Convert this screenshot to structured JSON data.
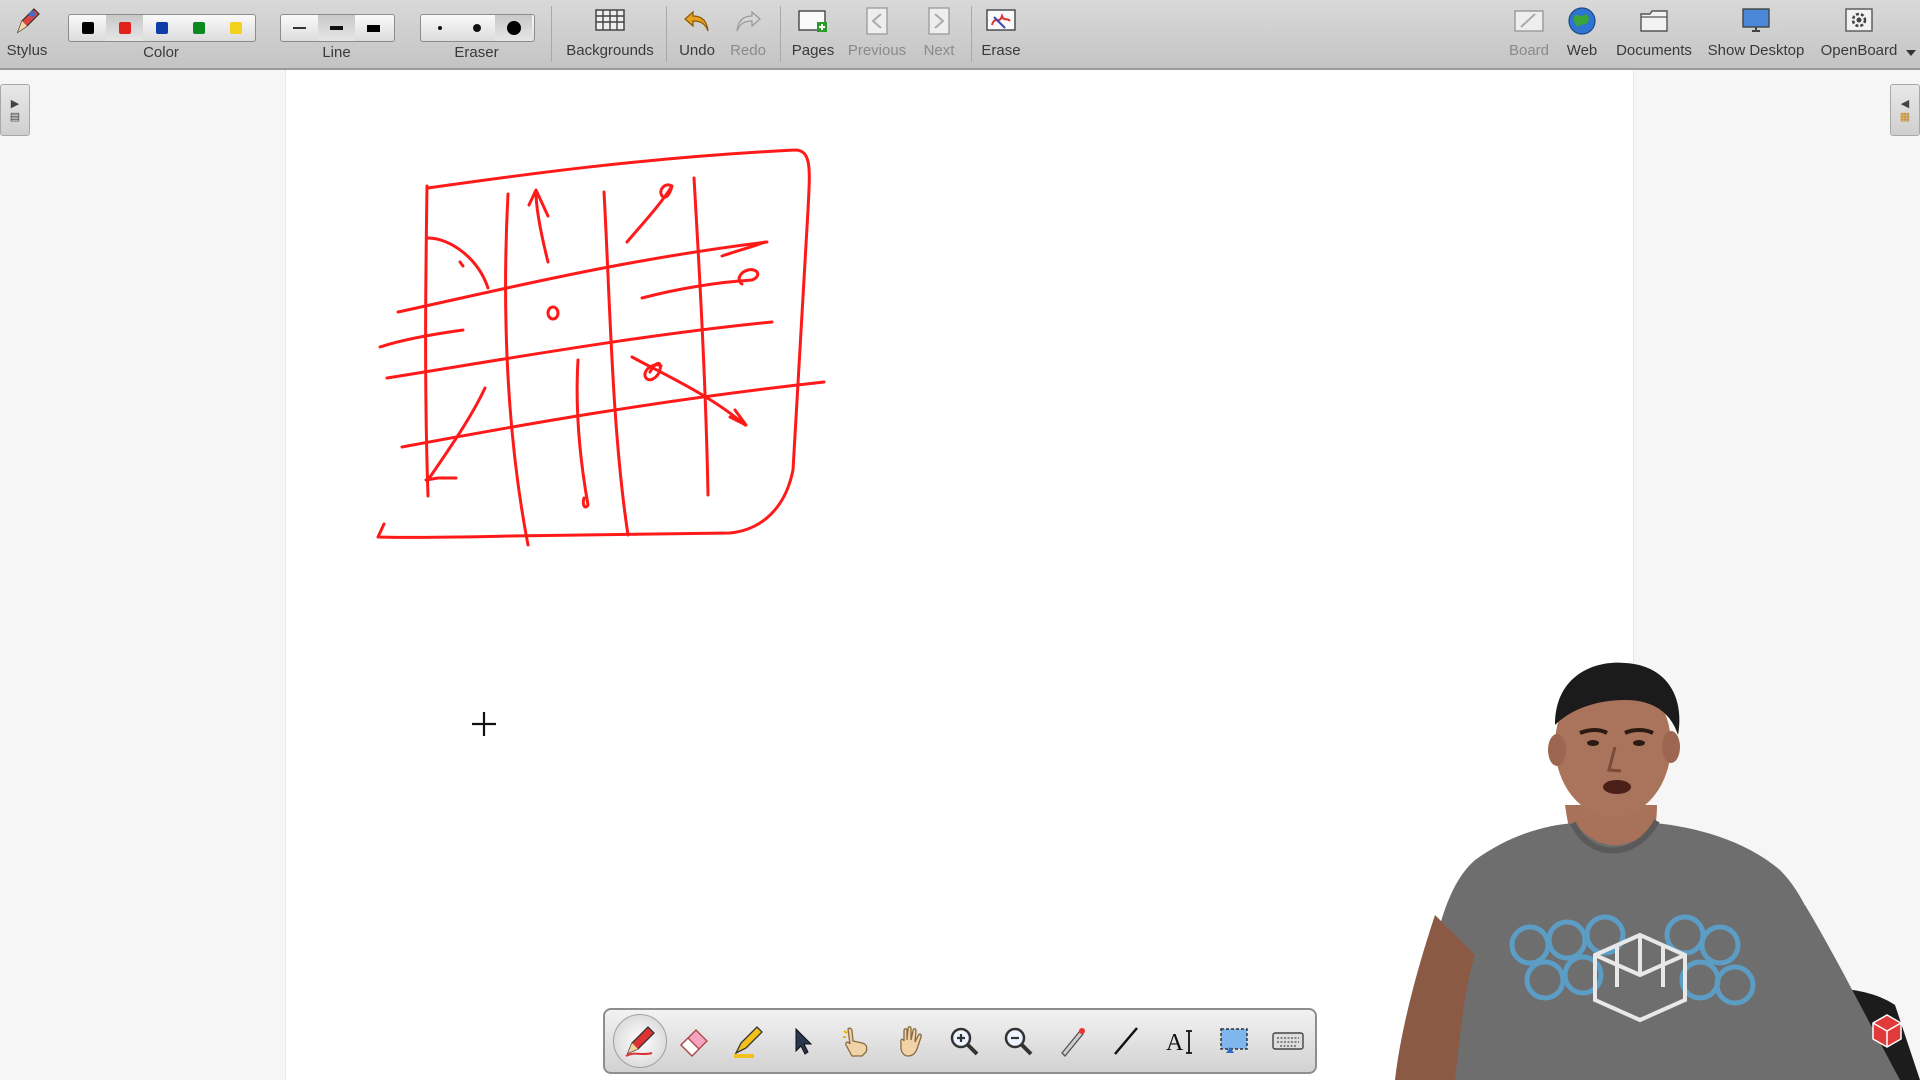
{
  "toolbar": {
    "stylus": "Stylus",
    "color": "Color",
    "line": "Line",
    "eraser": "Eraser",
    "backgrounds": "Backgrounds",
    "undo": "Undo",
    "redo": "Redo",
    "pages": "Pages",
    "previous": "Previous",
    "next": "Next",
    "erase": "Erase",
    "board": "Board",
    "web": "Web",
    "documents": "Documents",
    "show_desktop": "Show Desktop",
    "openboard": "OpenBoard",
    "colors": [
      "#000000",
      "#e0211c",
      "#0b3ea8",
      "#0a8a1e",
      "#f2d21a"
    ],
    "selected_color_index": 1,
    "ink_color": "#ff1a1a"
  },
  "floating_tools": [
    {
      "name": "pen-tool",
      "icon": "pen-icon",
      "active": true
    },
    {
      "name": "eraser-tool",
      "icon": "eraser-icon"
    },
    {
      "name": "marker-tool",
      "icon": "marker-icon"
    },
    {
      "name": "selector-tool",
      "icon": "arrow-pointer-icon"
    },
    {
      "name": "play-tool",
      "icon": "pointing-hand-icon"
    },
    {
      "name": "hand-tool",
      "icon": "hand-icon"
    },
    {
      "name": "zoom-in-tool",
      "icon": "zoom-in-icon"
    },
    {
      "name": "zoom-out-tool",
      "icon": "zoom-out-icon"
    },
    {
      "name": "laser-pointer-tool",
      "icon": "laser-pointer-icon"
    },
    {
      "name": "line-tool",
      "icon": "line-icon"
    },
    {
      "name": "text-tool",
      "icon": "text-icon"
    },
    {
      "name": "capture-tool",
      "icon": "capture-icon"
    },
    {
      "name": "keyboard-tool",
      "icon": "keyboard-icon"
    }
  ]
}
